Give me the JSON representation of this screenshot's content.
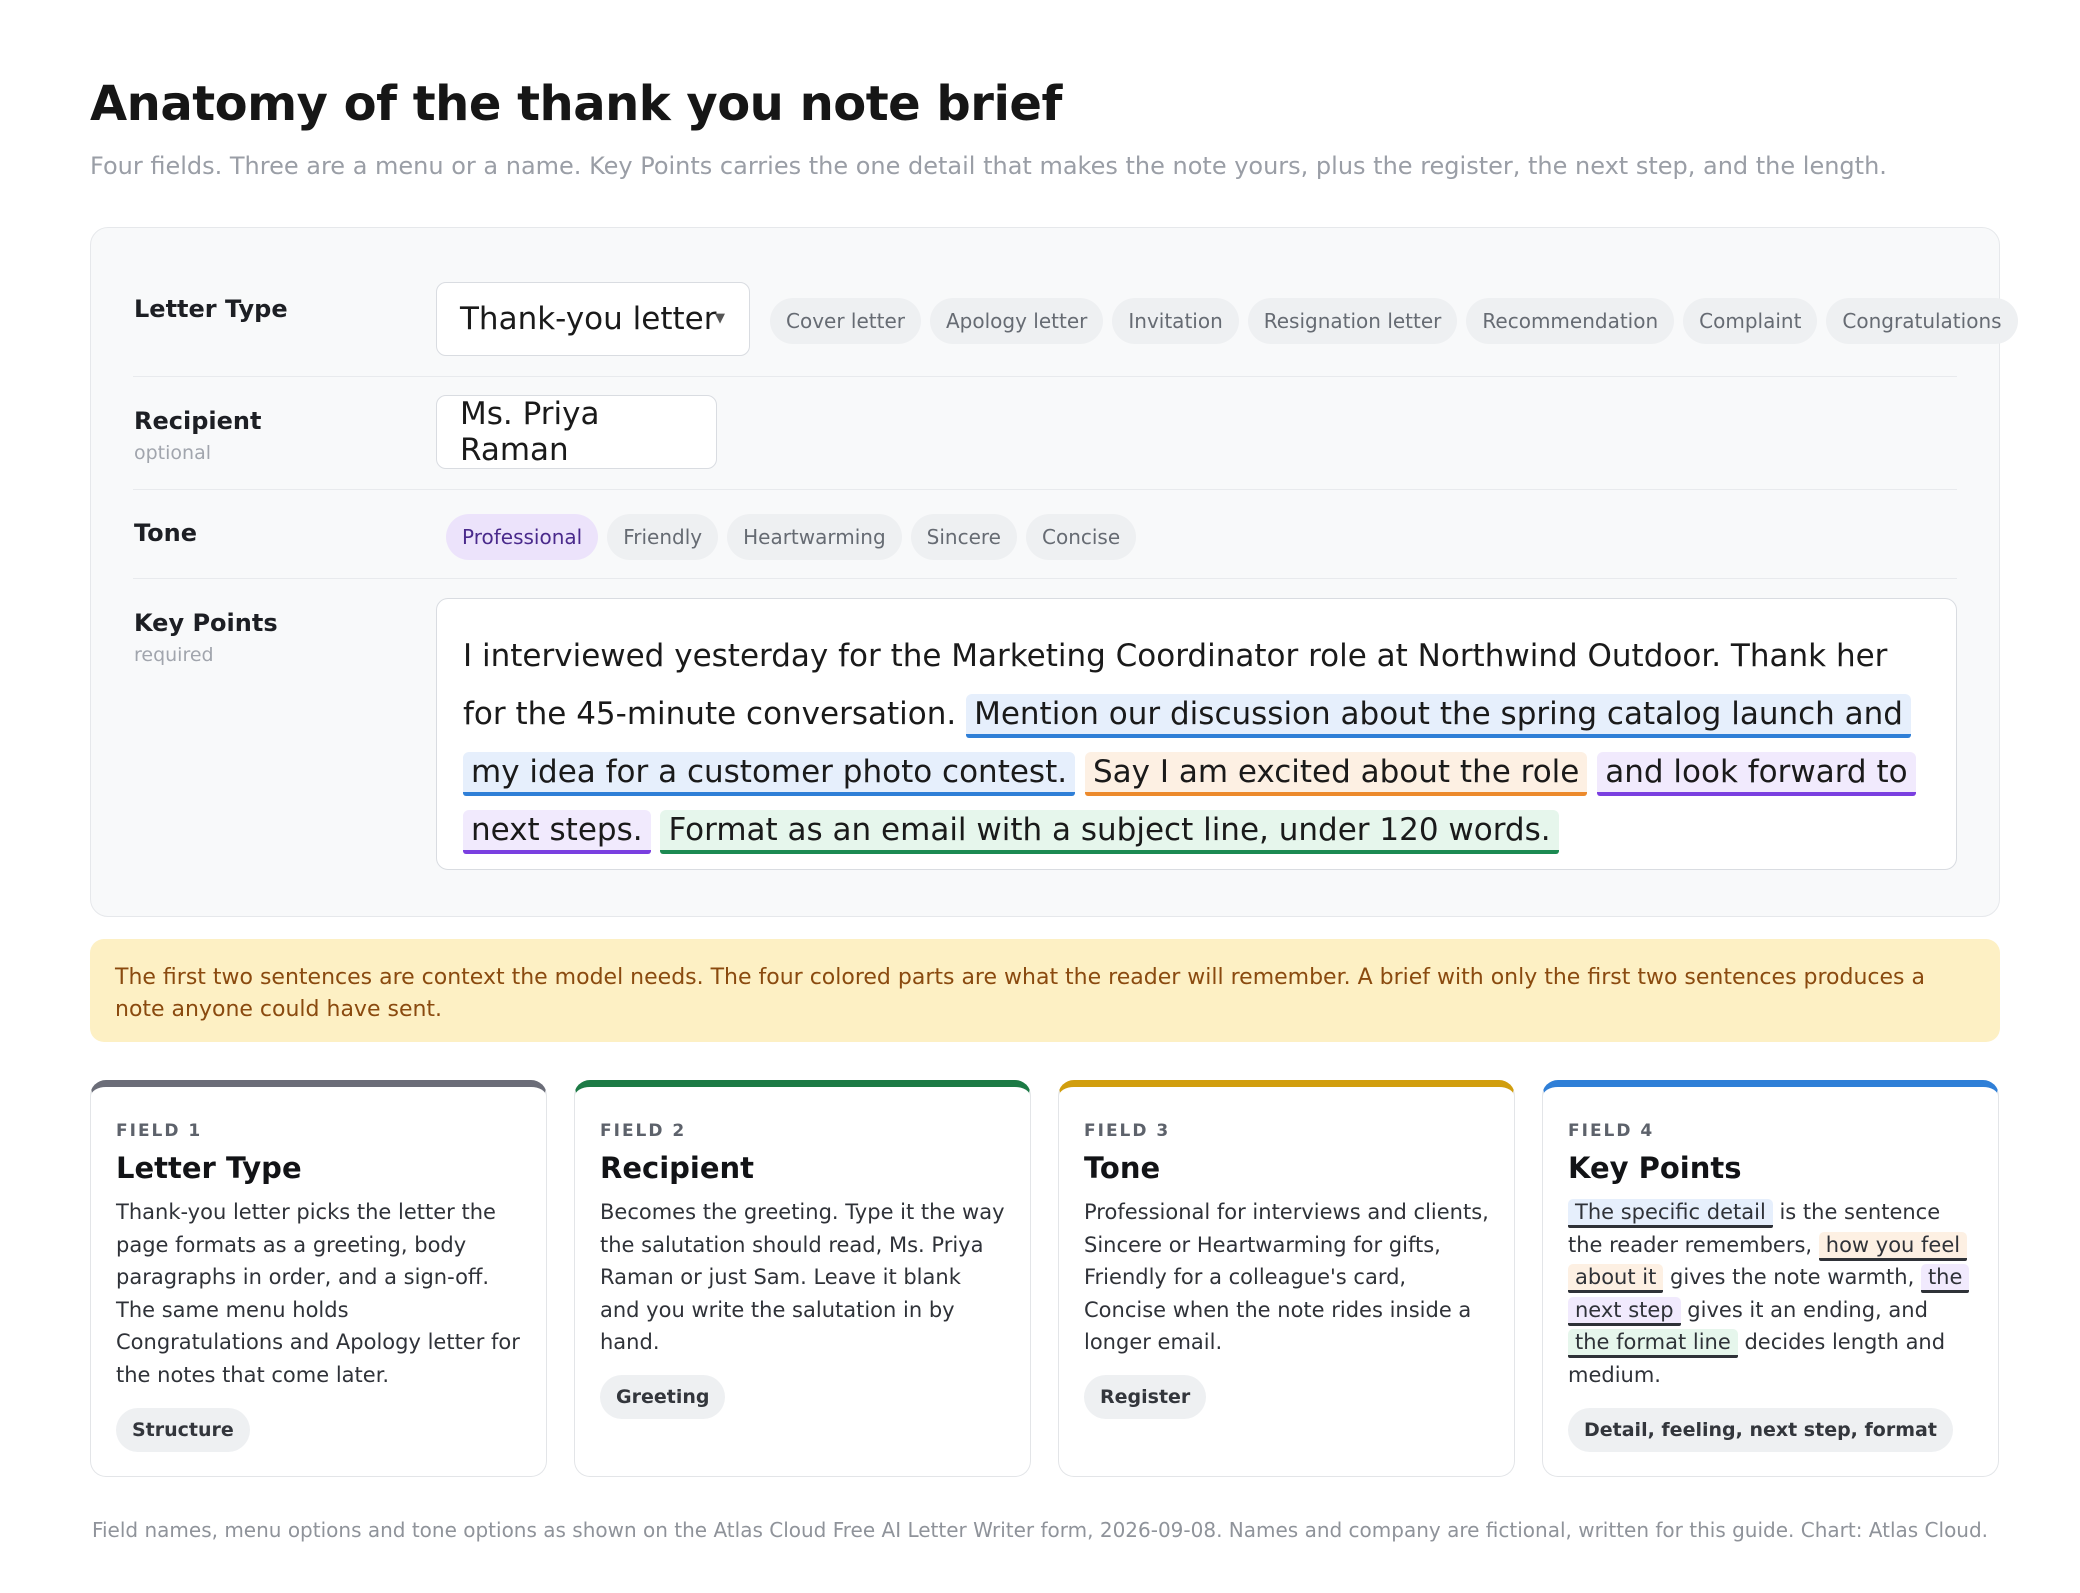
{
  "header": {
    "title": "Anatomy of the thank you note brief",
    "subtitle": "Four fields. Three are a menu or a name. Key Points carries the one detail that makes the note yours, plus the register, the next step, and the length."
  },
  "form": {
    "letter_type": {
      "label": "Letter Type",
      "selected": "Thank-you letter",
      "options": [
        "Cover letter",
        "Apology letter",
        "Invitation",
        "Resignation letter",
        "Recommendation",
        "Complaint",
        "Congratulations"
      ]
    },
    "recipient": {
      "label": "Recipient",
      "sub": "optional",
      "value": "Ms. Priya Raman"
    },
    "tone": {
      "label": "Tone",
      "options": [
        "Professional",
        "Friendly",
        "Heartwarming",
        "Sincere",
        "Concise"
      ],
      "selected": "Professional"
    },
    "key_points": {
      "label": "Key Points",
      "sub": "required",
      "context": "I interviewed yesterday for the Marketing Coordinator role at Northwind Outdoor. Thank her for the 45-minute conversation.",
      "detail": "Mention our discussion about the spring catalog launch and my idea for a customer photo contest.",
      "feeling": "Say I am excited about the role",
      "next_step": "and look forward to next steps.",
      "format": "Format as an email with a subject line, under 120 words."
    }
  },
  "callout": "The first two sentences are context the model needs. The four colored parts are what the reader will remember. A brief with only the first two sentences produces a note anyone could have sent.",
  "cards": [
    {
      "kicker": "FIELD 1",
      "title": "Letter Type",
      "body": "Thank-you letter picks the letter the page formats as a greeting, body paragraphs in order, and a sign-off. The same menu holds Congratulations and Apology letter for the notes that come later.",
      "tag": "Structure",
      "accent": "#6b6d78"
    },
    {
      "kicker": "FIELD 2",
      "title": "Recipient",
      "body": "Becomes the greeting. Type it the way the salutation should read, Ms. Priya Raman or just Sam. Leave it blank and you write the salutation in by hand.",
      "tag": "Greeting",
      "accent": "#1c7a45"
    },
    {
      "kicker": "FIELD 3",
      "title": "Tone",
      "body": "Professional for interviews and clients, Sincere or Heartwarming for gifts, Friendly for a colleague's card, Concise when the note rides inside a longer email.",
      "tag": "Register",
      "accent": "#d19e0e"
    },
    {
      "kicker": "FIELD 4",
      "title": "Key Points",
      "body_parts": {
        "p1": "The specific detail",
        "t1": " is the sentence the reader remembers, ",
        "p2": "how you feel about it",
        "t2": " gives the note warmth, ",
        "p3": "the next step",
        "t3": " gives it an ending, and ",
        "p4": "the format line",
        "t4": " decides length and medium."
      },
      "tag": "Detail, feeling, next step, format",
      "accent": "#2f7fd7"
    }
  ],
  "footer": "Field names, menu options and tone options as shown on the Atlas Cloud Free AI Letter Writer form, 2026-09-08. Names and company are fictional, written for this guide. Chart: Atlas Cloud.",
  "colors": {
    "detail": "#2f7fd7",
    "feeling": "#ec8a2c",
    "next_step": "#7a3fe0",
    "format": "#1c8a52",
    "tone_selected": "#ece3fb",
    "callout_bg": "#fdf0c4"
  },
  "icons": {
    "select_caret": "caret-down-icon"
  }
}
